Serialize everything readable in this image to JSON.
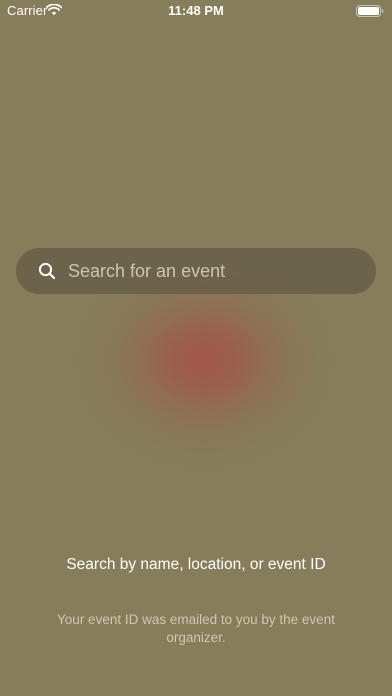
{
  "status_bar": {
    "carrier": "Carrier",
    "time": "11:48 PM",
    "wifi_icon": "wifi-icon",
    "battery_icon": "battery-icon"
  },
  "search": {
    "placeholder": "Search for an event",
    "value": "",
    "icon": "search-icon"
  },
  "hint": {
    "title": "Search by name, location, or event ID",
    "subtitle": "Your event ID was emailed to you by the event organizer."
  },
  "colors": {
    "background": "#867d5b",
    "glow": "#a65048",
    "text": "#ffffff"
  }
}
